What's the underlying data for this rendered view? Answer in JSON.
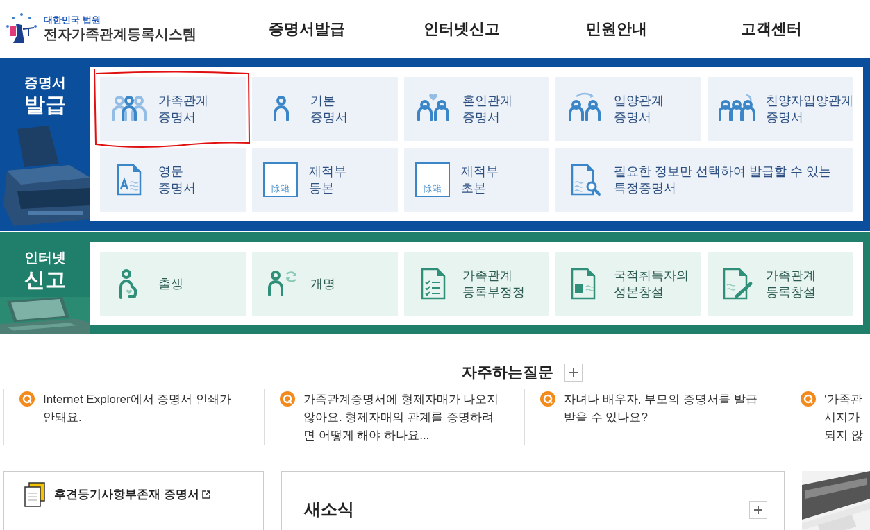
{
  "logo": {
    "org": "대한민국 법원",
    "system": "전자가족관계등록시스템"
  },
  "nav": [
    "증명서발급",
    "인터넷신고",
    "민원안내",
    "고객센터"
  ],
  "sections": [
    {
      "kind": "blue",
      "title_small": "증명서",
      "title_large": "발급",
      "tiles": [
        {
          "kind": "family",
          "lines": [
            "가족관계",
            "증명서"
          ]
        },
        {
          "kind": "person",
          "lines": [
            "기본",
            "증명서"
          ]
        },
        {
          "kind": "couple",
          "lines": [
            "혼인관계",
            "증명서"
          ]
        },
        {
          "kind": "adopt",
          "lines": [
            "입양관계",
            "증명서"
          ]
        },
        {
          "kind": "adopt3",
          "lines": [
            "친양자입양관계",
            "증명서"
          ]
        },
        {
          "kind": "doca",
          "lines": [
            "영문",
            "증명서"
          ]
        },
        {
          "kind": "seal",
          "seal": "除籍",
          "lines": [
            "제적부",
            "등본"
          ]
        },
        {
          "kind": "seal",
          "seal": "除籍",
          "lines": [
            "제적부",
            "초본"
          ]
        },
        {
          "kind": "search",
          "wide": true,
          "lines": [
            "필요한 정보만 선택하여 발급할 수 있는",
            "특정증명서"
          ]
        }
      ]
    },
    {
      "kind": "green",
      "title_small": "인터넷",
      "title_large": "신고",
      "tiles": [
        {
          "kind": "birth",
          "lines": [
            "출생"
          ]
        },
        {
          "kind": "rename",
          "lines": [
            "개명"
          ]
        },
        {
          "kind": "checklist",
          "lines": [
            "가족관계",
            "등록부정정"
          ]
        },
        {
          "kind": "idcard",
          "lines": [
            "국적취득자의",
            "성본창설"
          ]
        },
        {
          "kind": "pendoc",
          "lines": [
            "가족관계",
            "등록창설"
          ]
        }
      ]
    }
  ],
  "faq": {
    "title": "자주하는질문",
    "items": [
      {
        "lines": [
          "Internet Explorer에서 증명서 인쇄가",
          "안돼요."
        ]
      },
      {
        "lines": [
          "가족관계증명서에 형제자매가 나오지",
          "않아요. 형제자매의 관계를 증명하려",
          "면 어떻게 해야 하나요..."
        ]
      },
      {
        "lines": [
          "자녀나 배우자, 부모의 증명서를 발급",
          "받을 수 있나요?"
        ]
      },
      {
        "lines": [
          "‘가족관",
          "시지가",
          "되지 않"
        ]
      }
    ]
  },
  "quick_link": "후견등기사항부존재 증명서",
  "news": {
    "title": "새소식"
  }
}
